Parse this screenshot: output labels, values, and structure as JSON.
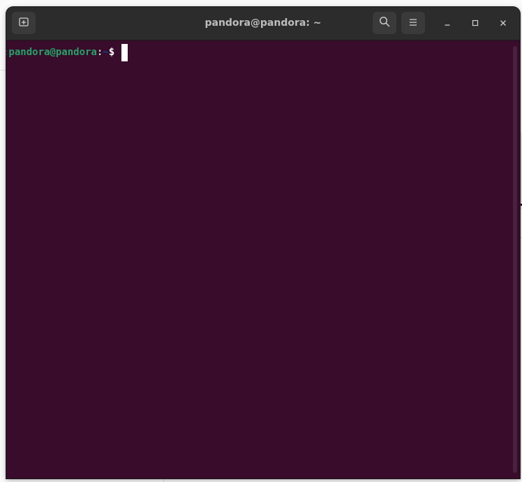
{
  "window": {
    "title": "pandora@pandora: ~"
  },
  "header": {
    "new_tab_icon": "new-tab-icon",
    "search_icon": "search-icon",
    "menu_icon": "hamburger-menu-icon",
    "minimize_icon": "minimize-icon",
    "maximize_icon": "maximize-icon",
    "close_icon": "close-icon"
  },
  "terminal": {
    "prompt_user_host": ":pandora@pandora",
    "prompt_colon": ":",
    "prompt_path": "~",
    "prompt_symbol": "$ "
  },
  "colors": {
    "terminal_bg": "#380c2a",
    "titlebar_bg": "#2c2c2c",
    "prompt_user": "#26a269",
    "prompt_path": "#12488b"
  }
}
